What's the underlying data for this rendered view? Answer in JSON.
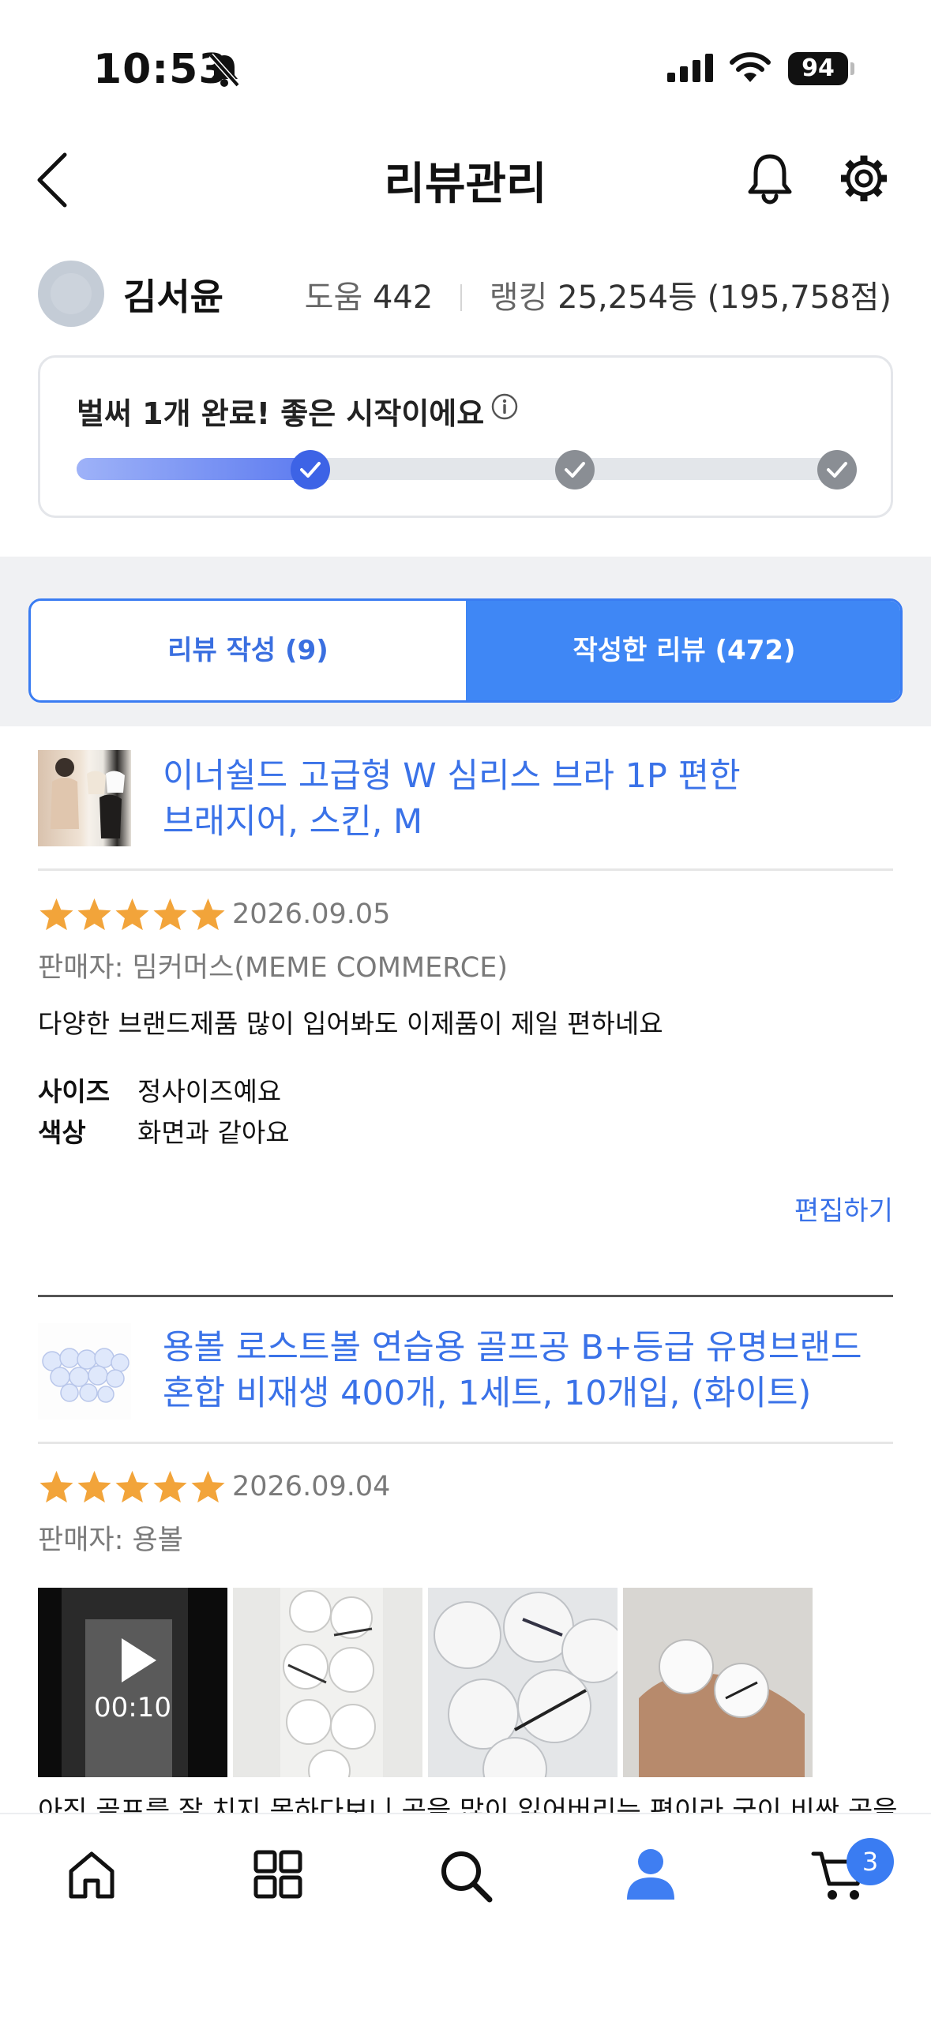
{
  "status_bar": {
    "time": "10:53",
    "battery": "94"
  },
  "header": {
    "title": "리뷰관리"
  },
  "profile": {
    "name": "김서윤",
    "help_label": "도움",
    "help_count": "442",
    "rank_label": "랭킹",
    "rank_value": "25,254등 (195,758점)"
  },
  "progress": {
    "message": "벌써 1개 완료! 좋은 시작이에요",
    "fraction": 0.3,
    "steps_total": 3,
    "steps_done": 1
  },
  "tabs": {
    "write": "리뷰 작성 (9)",
    "written": "작성한 리뷰 (472)",
    "active": "written"
  },
  "reviews": [
    {
      "product": "이너쉴드 고급형 W 심리스 브라 1P 편한 브래지어, 스킨, M",
      "product_line1": "이너쉴드 고급형 W 심리스 브라 1P 편한",
      "product_line2": "브래지어, 스킨, M",
      "rating": 5,
      "date": "2026.09.05",
      "seller": "판매자: 밈커머스(MEME COMMERCE)",
      "text": "다양한 브랜드제품 많이 입어봐도 이제품이 제일 편하네요",
      "options": [
        {
          "key": "사이즈",
          "value": "정사이즈예요"
        },
        {
          "key": "색상",
          "value": "화면과 같아요"
        }
      ],
      "edit_label": "편집하기"
    },
    {
      "product": "용볼 로스트볼 연습용 골프공 B+등급 유명브랜드 혼합 비재생 400개, 1세트, 10개입, (화이트)",
      "product_line1": "용볼 로스트볼 연습용 골프공 B+등급 유명브랜드",
      "product_line2": "혼합 비재생 400개, 1세트, 10개입, (화이트)",
      "rating": 5,
      "date": "2026.09.04",
      "seller": "판매자: 용볼",
      "video_duration": "00:10",
      "text_truncated": "아직 골프를 잘 치지 못하다보니 공을 많이 잃어버리는 편이라 굳이 비싼 공을"
    }
  ],
  "bottom_nav": {
    "items": [
      "home-icon",
      "category-icon",
      "search-icon",
      "profile-icon",
      "cart-icon"
    ],
    "cart_count": "3",
    "active": "profile-icon"
  },
  "colors": {
    "accent": "#3f87f5",
    "link": "#3a72e8",
    "star": "#f2a43a"
  }
}
